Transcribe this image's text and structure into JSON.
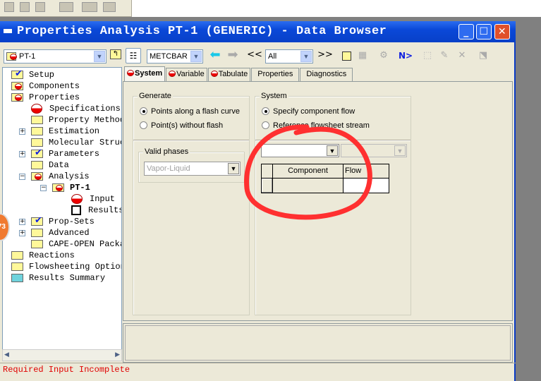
{
  "window": {
    "title": "Properties Analysis PT-1 (GENERIC) - Data Browser",
    "buttons": [
      "minimize",
      "maximize",
      "close"
    ]
  },
  "toolbar": {
    "object_select": "PT-1",
    "units_select": "METCBAR",
    "filter_select": "All",
    "prev_label": "<<",
    "next_label": ">>",
    "next_required_label": "N>",
    "icons": [
      "up-folder-icon",
      "tree-toggle-icon",
      "back-arrow-icon",
      "forward-arrow-icon",
      "notes-icon",
      "status-icon",
      "setup-icon",
      "next-icon",
      "copy-icon",
      "edit-icon",
      "delete-icon",
      "results-icon"
    ]
  },
  "tree": [
    {
      "label": "Setup",
      "icon": "check"
    },
    {
      "label": "Components",
      "icon": "red"
    },
    {
      "label": "Properties",
      "icon": "red"
    },
    {
      "label": "Specifications",
      "icon": "red-circle"
    },
    {
      "label": "Property Methods",
      "icon": "folder"
    },
    {
      "label": "Estimation",
      "icon": "folder"
    },
    {
      "label": "Molecular Structure",
      "icon": "folder"
    },
    {
      "label": "Parameters",
      "icon": "check"
    },
    {
      "label": "Data",
      "icon": "folder"
    },
    {
      "label": "Analysis",
      "icon": "red"
    },
    {
      "label": "PT-1",
      "icon": "red"
    },
    {
      "label": "Input",
      "icon": "red-circle"
    },
    {
      "label": "Results",
      "icon": "empty-square"
    },
    {
      "label": "Prop-Sets",
      "icon": "check"
    },
    {
      "label": "Advanced",
      "icon": "folder"
    },
    {
      "label": "CAPE-OPEN Packages",
      "icon": "folder"
    },
    {
      "label": "Reactions",
      "icon": "folder"
    },
    {
      "label": "Flowsheeting Options",
      "icon": "folder"
    },
    {
      "label": "Results Summary",
      "icon": "teal-folder"
    }
  ],
  "tabs": [
    {
      "label": "System",
      "status": "incomplete"
    },
    {
      "label": "Variable",
      "status": "incomplete"
    },
    {
      "label": "Tabulate",
      "status": "incomplete"
    },
    {
      "label": "Properties"
    },
    {
      "label": "Diagnostics"
    }
  ],
  "generate": {
    "title": "Generate",
    "options": [
      "Points along a flash curve",
      "Point(s) without flash"
    ],
    "selected": 0,
    "valid_phases": {
      "title": "Valid phases",
      "value": "Vapor-Liquid"
    }
  },
  "system": {
    "title": "System",
    "options": [
      "Specify component flow",
      "Reference flowsheet stream"
    ],
    "selected": 0,
    "table": {
      "headers": [
        "Component",
        "Flow"
      ]
    }
  },
  "status_bar": {
    "text": "Required Input Incomplete"
  },
  "colors": {
    "annotation": "#ff3030",
    "title_bar": "#0a48d8",
    "status_text": "#e00000"
  }
}
